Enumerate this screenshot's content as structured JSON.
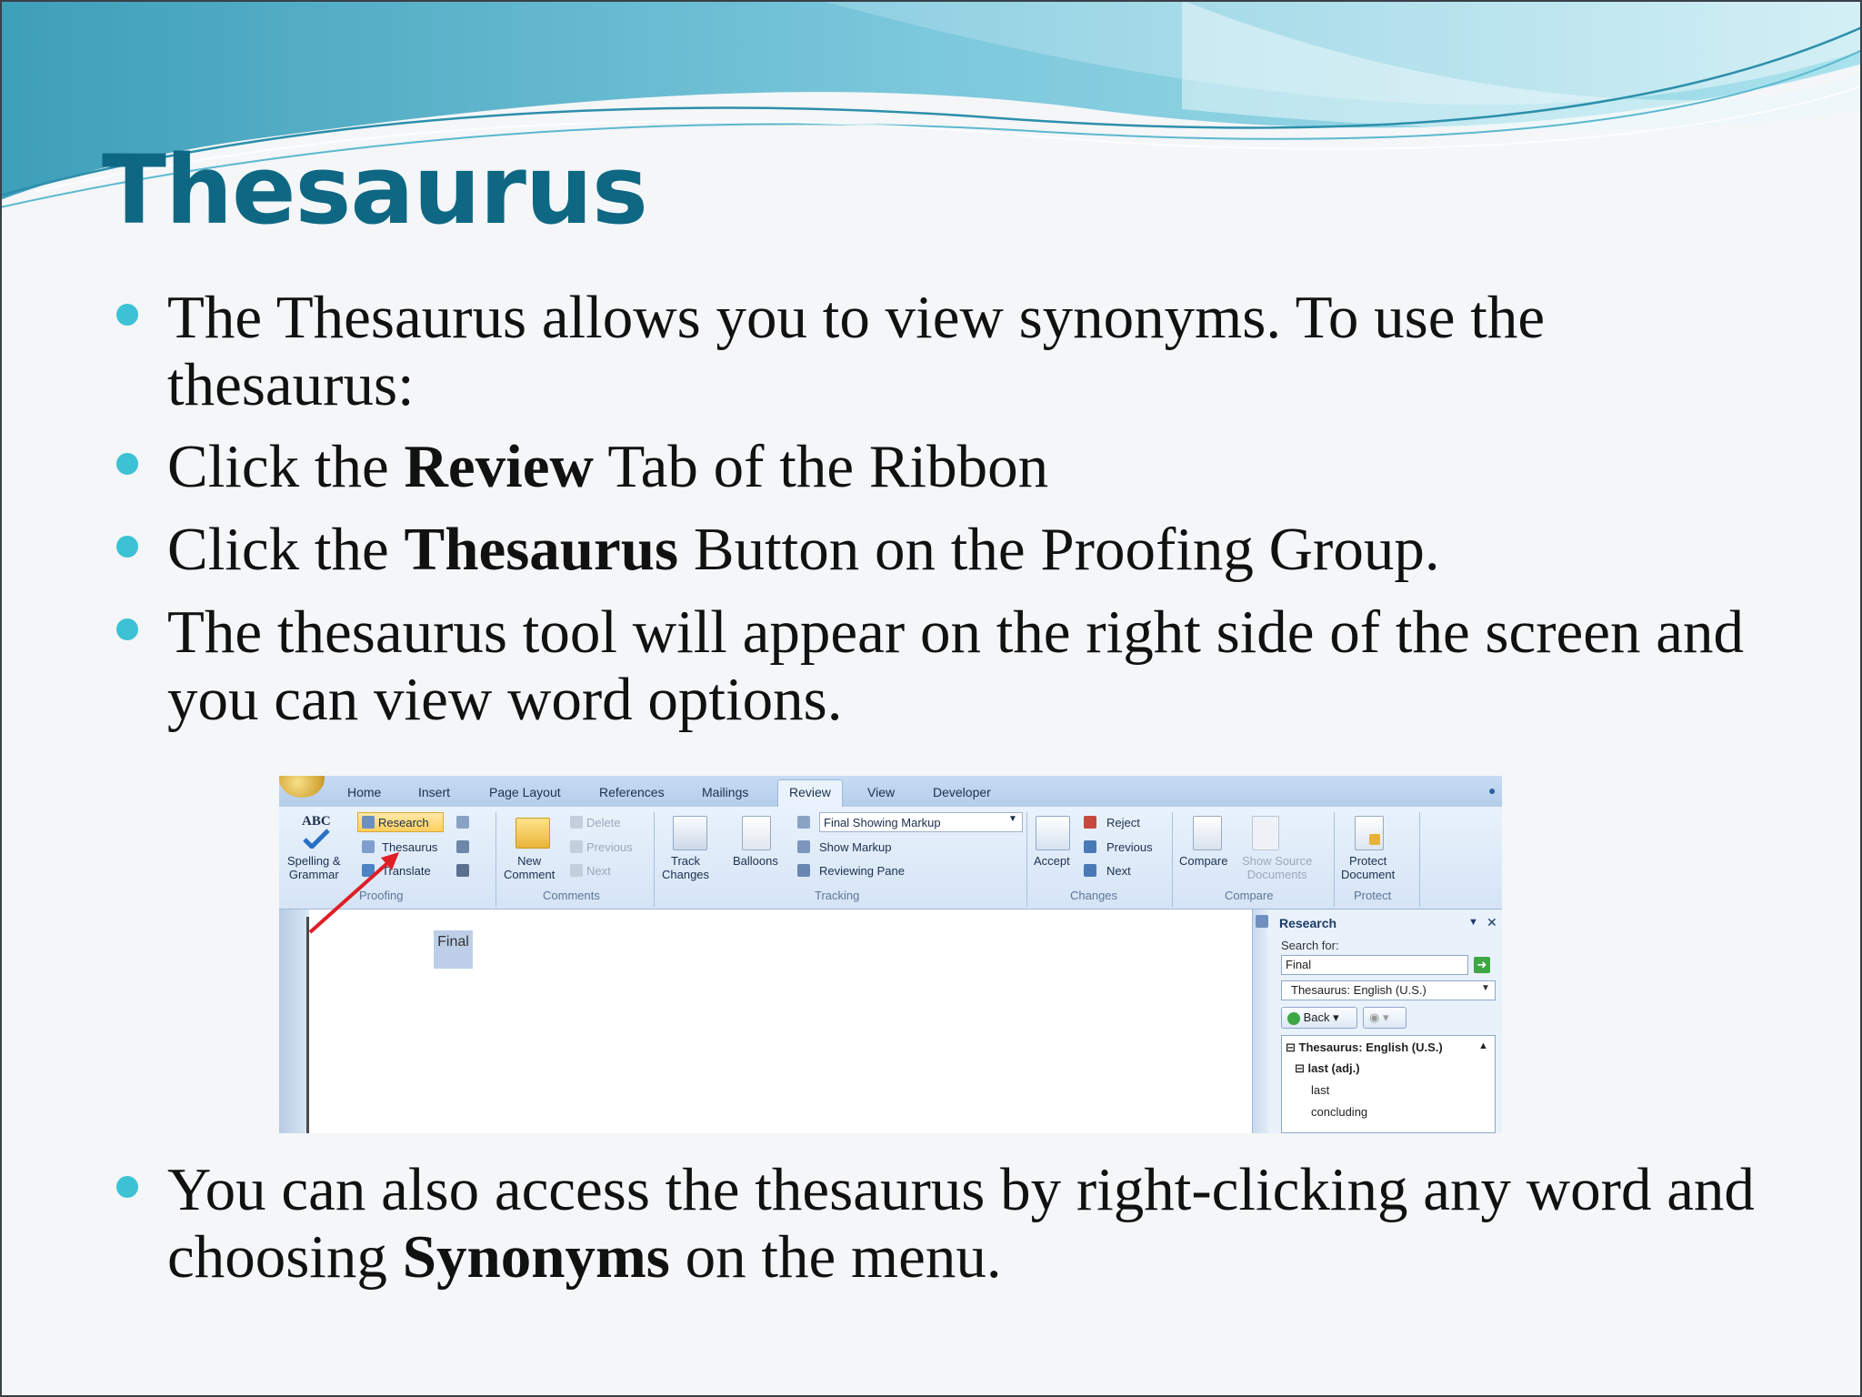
{
  "slide": {
    "title": "Thesaurus",
    "bullets": [
      {
        "text": "The Thesaurus allows you to view synonyms. To use the thesaurus:"
      },
      {
        "pre": "Click the ",
        "bold": "Review",
        "post": " Tab of the Ribbon"
      },
      {
        "pre": "Click the ",
        "bold": "Thesaurus",
        "post": " Button on the Proofing Group."
      },
      {
        "text": "The thesaurus tool will appear on the right side of the screen and you can view word options."
      },
      {
        "pre": "You can also access the thesaurus by right-clicking any word and choosing ",
        "bold": "Synonyms",
        "post": " on the menu."
      }
    ]
  },
  "screenshot": {
    "tabs": [
      "Home",
      "Insert",
      "Page Layout",
      "References",
      "Mailings",
      "Review",
      "View",
      "Developer"
    ],
    "active_tab": "Review",
    "proofing": {
      "spelling_line1": "Spelling &",
      "spelling_line2": "Grammar",
      "abc": "ABC",
      "research": "Research",
      "thesaurus": "Thesaurus",
      "translate": "Translate",
      "group": "Proofing"
    },
    "comments": {
      "new_line1": "New",
      "new_line2": "Comment",
      "delete": "Delete",
      "previous": "Previous",
      "next": "Next",
      "group": "Comments"
    },
    "tracking": {
      "track_line1": "Track",
      "track_line2": "Changes",
      "balloons": "Balloons",
      "final_showing_markup": "Final Showing Markup",
      "show_markup": "Show Markup",
      "reviewing_pane": "Reviewing Pane",
      "group": "Tracking"
    },
    "changes": {
      "accept": "Accept",
      "reject": "Reject",
      "previous": "Previous",
      "next": "Next",
      "group": "Changes"
    },
    "compare": {
      "compare": "Compare",
      "show_source_line1": "Show Source",
      "show_source_line2": "Documents",
      "group": "Compare"
    },
    "protect": {
      "protect_line1": "Protect",
      "protect_line2": "Document",
      "group": "Protect"
    },
    "document": {
      "word": "Final"
    },
    "research_pane": {
      "title": "Research",
      "search_for_label": "Search for:",
      "search_value": "Final",
      "source": "Thesaurus: English (U.S.)",
      "back": "Back",
      "results_header": "Thesaurus: English (U.S.)",
      "entry": "last (adj.)",
      "words": [
        "last",
        "concluding"
      ]
    },
    "colors": {
      "arrow": "#e01e26",
      "title": "#0f6883",
      "bullet": "#3cc2d4"
    }
  }
}
